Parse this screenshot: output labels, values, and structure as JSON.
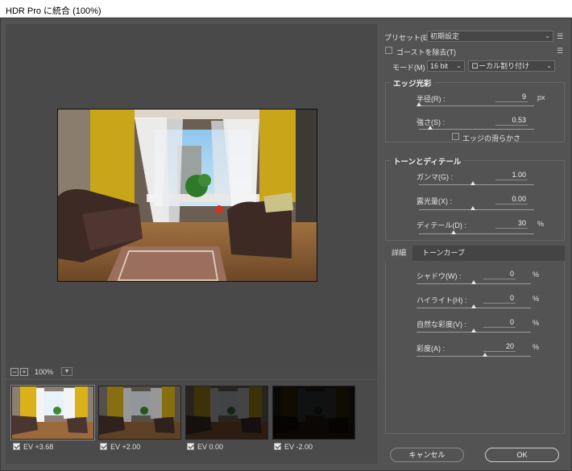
{
  "window": {
    "title": "HDR Pro に統合 (100%)"
  },
  "preset": {
    "label": "プリセット(E) :",
    "value": "初期設定"
  },
  "ghost": {
    "label": "ゴーストを除去(T)"
  },
  "mode": {
    "label": "モード(M) :",
    "bitdepth": "16 bit",
    "method": "ローカル割り付け"
  },
  "edge_glow": {
    "title": "エッジ光彩",
    "radius": {
      "label": "半径(R) :",
      "value": "9",
      "unit": "px",
      "level": 0.0
    },
    "strength": {
      "label": "強さ(S) :",
      "value": "0.53",
      "level": 0.1
    },
    "smooth_edges": {
      "label": "エッジの滑らかさ"
    }
  },
  "tone_detail": {
    "title": "トーンとディテール",
    "gamma": {
      "label": "ガンマ(G) :",
      "value": "1.00",
      "level": 0.47
    },
    "exposure": {
      "label": "露光量(X) :",
      "value": "0.00",
      "level": 0.47
    },
    "detail": {
      "label": "ディテール(D) :",
      "value": "30",
      "unit": "%",
      "level": 0.3
    }
  },
  "tabs": [
    {
      "label": "詳細"
    },
    {
      "label": "トーンカーブ"
    }
  ],
  "advanced": {
    "shadow": {
      "label": "シャドウ(W) :",
      "value": "0",
      "unit": "%",
      "level": 0.5
    },
    "highlight": {
      "label": "ハイライト(H) :",
      "value": "0",
      "unit": "%",
      "level": 0.5
    },
    "vibrance": {
      "label": "自然な彩度(V) :",
      "value": "0",
      "unit": "%",
      "level": 0.5
    },
    "saturation": {
      "label": "彩度(A) :",
      "value": "20",
      "unit": "%",
      "level": 0.6
    }
  },
  "zoom": {
    "value": "100%"
  },
  "thumbnails": [
    {
      "label": "EV +3.68",
      "brightness": 1.0
    },
    {
      "label": "EV +2.00",
      "brightness": 0.62
    },
    {
      "label": "EV 0.00",
      "brightness": 0.28
    },
    {
      "label": "EV -2.00",
      "brightness": 0.07
    }
  ],
  "buttons": {
    "cancel": "キャンセル",
    "ok": "OK"
  }
}
